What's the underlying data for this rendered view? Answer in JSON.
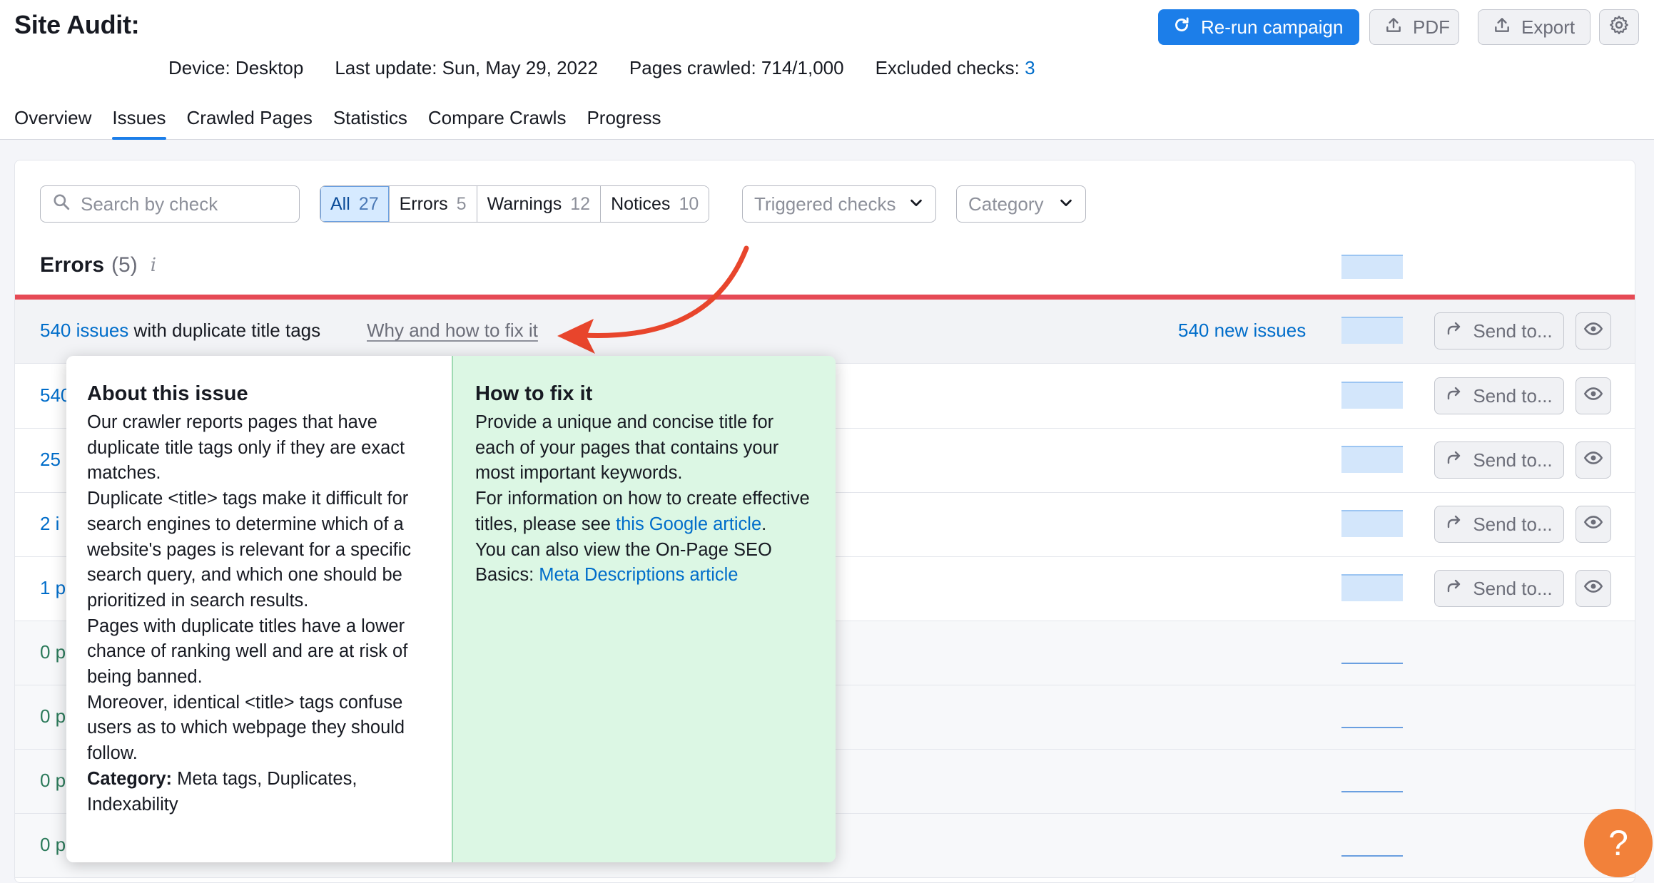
{
  "header": {
    "title": "Site Audit:",
    "device_label": "Device: Desktop",
    "last_update": "Last update: Sun, May 29, 2022",
    "pages_crawled": "Pages crawled: 714/1,000",
    "excluded_checks_label": "Excluded checks:",
    "excluded_checks_value": "3",
    "buttons": {
      "rerun": "Re-run campaign",
      "pdf": "PDF",
      "export": "Export"
    }
  },
  "tabs": [
    {
      "label": "Overview",
      "active": false
    },
    {
      "label": "Issues",
      "active": true
    },
    {
      "label": "Crawled Pages",
      "active": false
    },
    {
      "label": "Statistics",
      "active": false
    },
    {
      "label": "Compare Crawls",
      "active": false
    },
    {
      "label": "Progress",
      "active": false
    }
  ],
  "filters": {
    "search_placeholder": "Search by check",
    "segments": [
      {
        "label": "All",
        "count": "27",
        "active": true
      },
      {
        "label": "Errors",
        "count": "5",
        "active": false
      },
      {
        "label": "Warnings",
        "count": "12",
        "active": false
      },
      {
        "label": "Notices",
        "count": "10",
        "active": false
      }
    ],
    "triggered_checks": "Triggered checks",
    "category": "Category"
  },
  "errors_section": {
    "title": "Errors",
    "count": "(5)",
    "info_glyph": "i"
  },
  "rows": [
    {
      "link": "540 issues",
      "text": " with duplicate title tags",
      "why": "Why and how to fix it",
      "new_issues": "540 new issues",
      "send": "Send to...",
      "has_actions": true
    },
    {
      "link": "540",
      "text": "",
      "send": "Send to...",
      "has_actions": true
    },
    {
      "link": "25",
      "text": "",
      "send": "Send to...",
      "has_actions": true
    },
    {
      "link": "2 i",
      "text": "",
      "send": "Send to...",
      "has_actions": true
    },
    {
      "link": "1 p",
      "text": "",
      "send": "Send to...",
      "has_actions": true
    },
    {
      "text": "0 p",
      "has_actions": false
    },
    {
      "text": "0 p",
      "has_actions": false
    },
    {
      "text": "0 p",
      "has_actions": false
    },
    {
      "text": "0 p",
      "has_actions": false
    }
  ],
  "popover": {
    "about": {
      "heading": "About this issue",
      "paragraphs": [
        "Our crawler reports pages that have duplicate title tags only if they are exact matches.",
        "Duplicate <title> tags make it difficult for search engines to determine which of a website's pages is relevant for a specific search query, and which one should be prioritized in search results.",
        "Pages with duplicate titles have a lower chance of ranking well and are at risk of being banned.",
        "Moreover, identical <title> tags confuse users as to which webpage they should follow."
      ],
      "category_label": "Category:",
      "category_value": " Meta tags, Duplicates, Indexability"
    },
    "fix": {
      "heading": "How to fix it",
      "p1": "Provide a unique and concise title for each of your pages that contains your most important keywords.",
      "p2_prefix": "For information on how to create effective titles, please see ",
      "p2_link": "this Google article",
      "p2_suffix": ".",
      "p3_prefix": "You can also view the On-Page SEO Basics: ",
      "p3_link": "Meta Descriptions article"
    }
  },
  "help_button": "?",
  "colors": {
    "primary": "#1c7ee9",
    "link": "#006dca",
    "error_bar": "#e64a55",
    "fix_bg": "#dcf7e4",
    "annotation_arrow": "#e8452c",
    "help": "#f2813a"
  }
}
